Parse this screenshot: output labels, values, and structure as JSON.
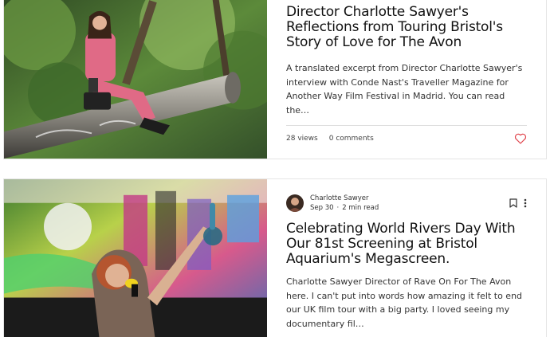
{
  "posts": [
    {
      "title": "Director Charlotte Sawyer's Reflections from Touring Bristol's Story of Love for The Avon",
      "excerpt": "A translated excerpt from Director Charlotte Sawyer's interview with Conde Nast's Traveller Magazine for Another Way Film Festival in Madrid. You can read the…",
      "views": "28 views",
      "comments": "0 comments",
      "liked": false
    },
    {
      "author": "Charlotte Sawyer",
      "date": "Sep 30",
      "separator": "·",
      "read_time": "2 min read",
      "title": "Celebrating World Rivers Day With Our 81st Screening at Bristol Aquarium's Megascreen.",
      "excerpt": "Charlotte Sawyer Director of Rave On For The Avon here. I can't put into words how amazing it felt to end our UK film tour with a big party. I loved seeing my documentary fil…"
    }
  ],
  "icons": {
    "like": "heart-icon",
    "save": "bookmark-icon",
    "more": "more-vertical-icon"
  },
  "colors": {
    "heart": "#e0434b",
    "divider": "#dedede"
  }
}
